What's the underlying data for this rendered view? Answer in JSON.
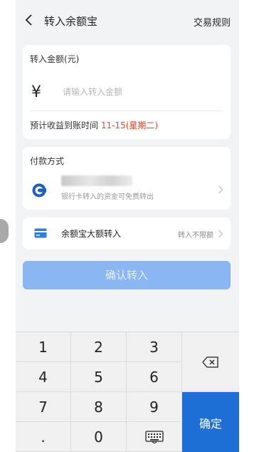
{
  "header": {
    "title": "转入余额宝",
    "rules_link": "交易规则"
  },
  "amount_card": {
    "label": "转入金额(元)",
    "currency": "¥",
    "input_placeholder": "请输入转入金额",
    "arrival_prefix": "预计收益到账时间 ",
    "arrival_date": "11-15(星期二)"
  },
  "payment_card": {
    "label": "付款方式",
    "bank_note": "银行卡转入的资金可免费转出"
  },
  "large_transfer": {
    "label": "余额宝大额转入",
    "limit": "转入不限额"
  },
  "confirm_button": "确认转入",
  "keypad": {
    "keys": [
      "1",
      "2",
      "3",
      "4",
      "5",
      "6",
      "7",
      "8",
      "9",
      ".",
      "0"
    ],
    "ok_label": "确定"
  },
  "colors": {
    "accent": "#1d6fd6",
    "date": "#e6453a",
    "button_disabled": "#8ab6f2"
  }
}
